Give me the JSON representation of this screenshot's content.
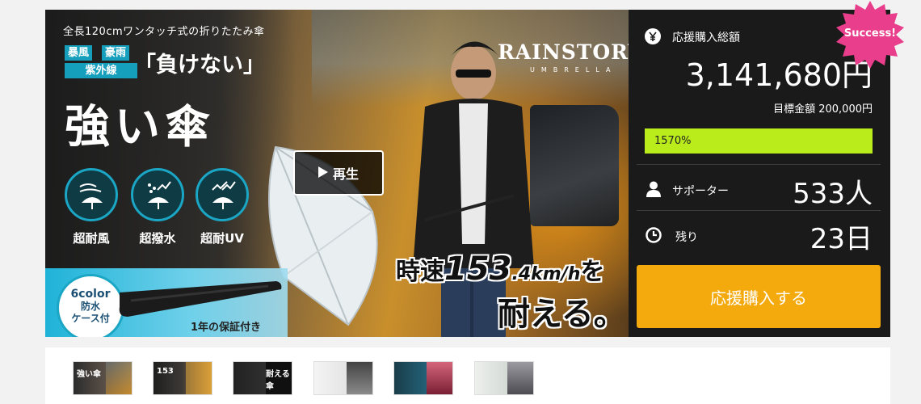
{
  "hero": {
    "top_caption": "全長120cmワンタッチ式の折りたたみ傘",
    "tag_storm": "暴風",
    "tag_rain": "豪雨",
    "tag_uv": "紫外線",
    "headline": "「負けない」",
    "big_title": "強い傘",
    "features": [
      "超耐風",
      "超撥水",
      "超耐UV"
    ],
    "logo": "RAINSTORY",
    "logo_sub": "UMBRELLA",
    "play_label": "再生",
    "speed_prefix": "時速",
    "speed_value": "153",
    "speed_unit": ".4km/h",
    "speed_suffix": "を",
    "endure": "耐える。",
    "color_badge_line1": "6color",
    "color_badge_line2": "防水",
    "color_badge_line3": "ケース付",
    "warranty": "1年の保証付き"
  },
  "side": {
    "total_label": "応援購入総額",
    "total_amount": "3,141,680円",
    "goal_text": "目標金額 200,000円",
    "progress_text": "1570%",
    "progress_percent": 1570,
    "supporters_label": "サポーター",
    "supporters_value": "533人",
    "remaining_label": "残り",
    "remaining_value": "23日",
    "cta_label": "応援購入する",
    "success_badge": "Success!"
  },
  "colors": {
    "panel_bg": "#1a1a1a",
    "progress_fill": "#b9ec1a",
    "cta": "#f4a90d",
    "badge": "#e83e8c",
    "accent_teal": "#169fbd"
  },
  "icons": {
    "total": "yen-icon",
    "supporters": "person-icon",
    "remaining": "clock-icon",
    "play": "play-icon"
  },
  "thumbnails": [
    {
      "label": "強い傘"
    },
    {
      "label": "153"
    },
    {
      "label": "耐える傘"
    },
    {
      "label": ""
    },
    {
      "label": ""
    },
    {
      "label": ""
    }
  ]
}
